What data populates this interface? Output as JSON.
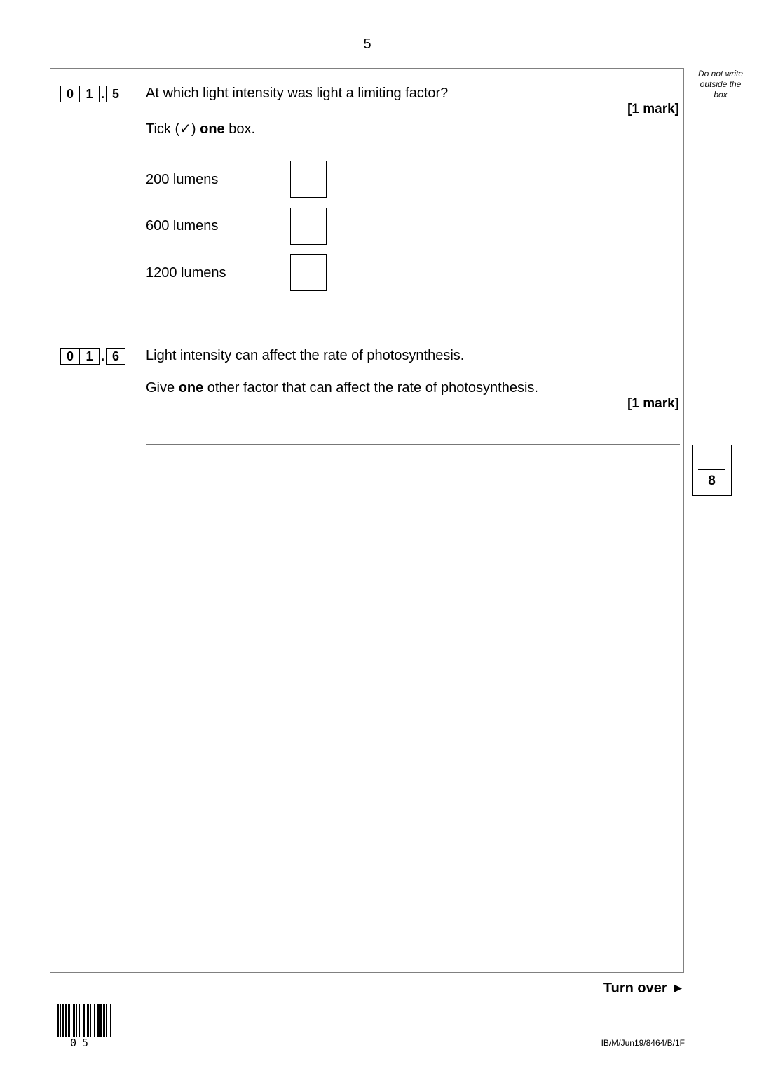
{
  "page": {
    "number": "5",
    "margin_note": "Do not write outside the box"
  },
  "questions": [
    {
      "number_digits": [
        "0",
        "1"
      ],
      "separator": ".",
      "part": "5",
      "text": "At which light intensity was light a limiting factor?",
      "marks": "[1 mark]",
      "instruction_prefix": "Tick (✓) ",
      "instruction_bold": "one",
      "instruction_suffix": " box.",
      "options": [
        {
          "label": "200 lumens",
          "checked": false
        },
        {
          "label": "600 lumens",
          "checked": false
        },
        {
          "label": "1200 lumens",
          "checked": false
        }
      ]
    },
    {
      "number_digits": [
        "0",
        "1"
      ],
      "separator": ".",
      "part": "6",
      "text": "Light intensity can affect the rate of photosynthesis.",
      "prompt_prefix": "Give ",
      "prompt_bold": "one",
      "prompt_suffix": " other factor that can affect the rate of photosynthesis.",
      "marks": "[1 mark]",
      "answer": ""
    }
  ],
  "score_box": {
    "awarded": "",
    "total": "8"
  },
  "footer": {
    "turn_over": "Turn over ►",
    "barcode_digits": "05",
    "reference": "IB/M/Jun19/8464/B/1F"
  }
}
